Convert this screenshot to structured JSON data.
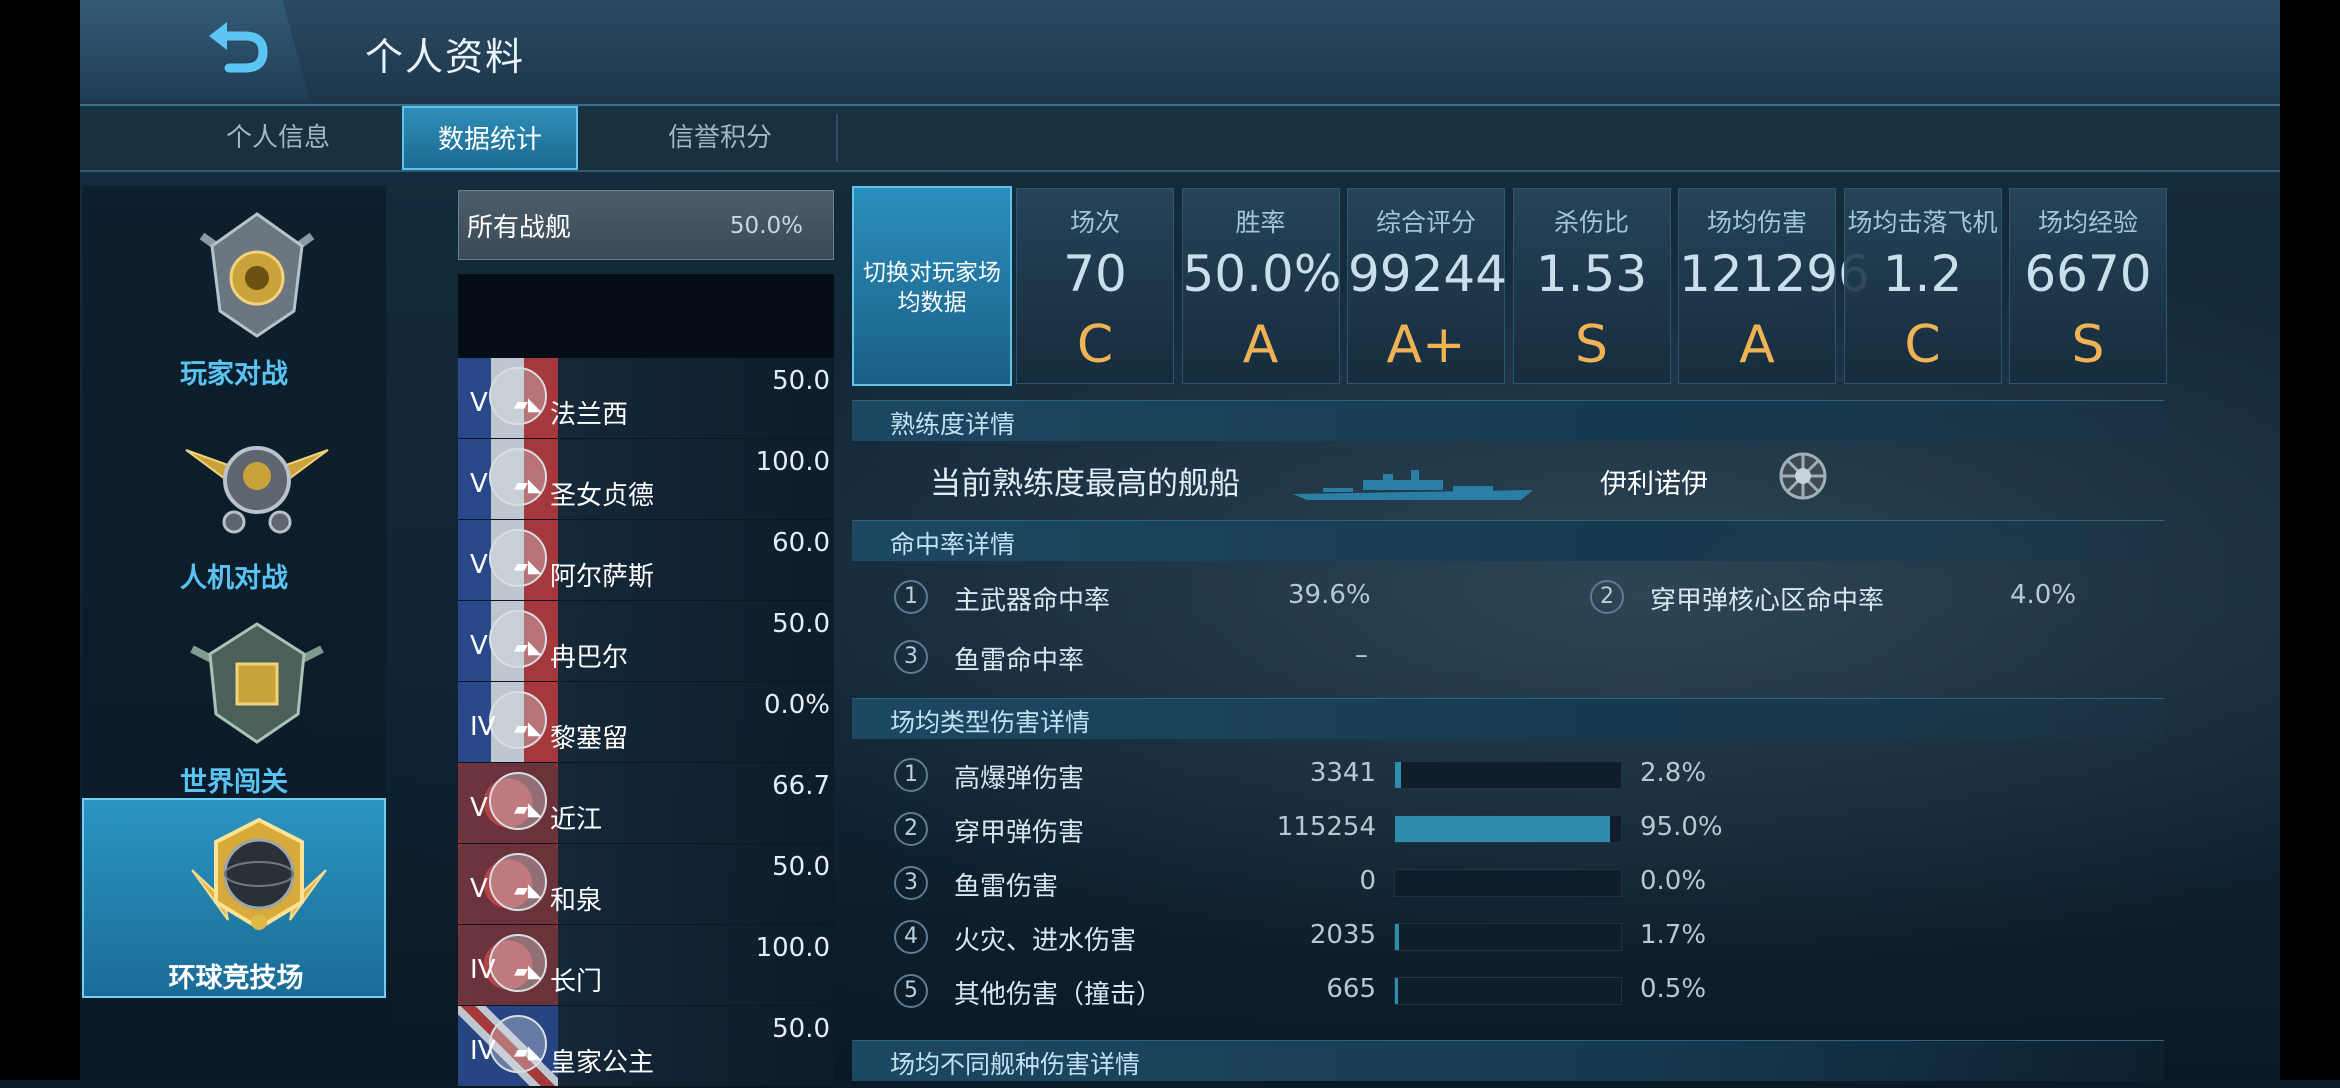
{
  "header": {
    "title": "个人资料"
  },
  "tabs": [
    {
      "label": "个人信息",
      "active": false
    },
    {
      "label": "数据统计",
      "active": true
    },
    {
      "label": "信誉积分",
      "active": false
    }
  ],
  "modes": [
    {
      "label": "玩家对战",
      "active": false
    },
    {
      "label": "人机对战",
      "active": false
    },
    {
      "label": "世界闯关",
      "active": false
    },
    {
      "label": "环球竞技场",
      "active": true
    }
  ],
  "ship_list": {
    "all": {
      "label": "所有战舰",
      "value": "50.0%"
    },
    "ships": [
      {
        "tier": "V",
        "name": "法兰西",
        "winrate": "50.0",
        "nation": "fr"
      },
      {
        "tier": "V",
        "name": "圣女贞德",
        "winrate": "100.0",
        "nation": "fr"
      },
      {
        "tier": "V",
        "name": "阿尔萨斯",
        "winrate": "60.0",
        "nation": "fr"
      },
      {
        "tier": "V",
        "name": "冉巴尔",
        "winrate": "50.0",
        "nation": "fr"
      },
      {
        "tier": "IV",
        "name": "黎塞留",
        "winrate": "0.0%",
        "nation": "fr"
      },
      {
        "tier": "V",
        "name": "近江",
        "winrate": "66.7",
        "nation": "jp"
      },
      {
        "tier": "V",
        "name": "和泉",
        "winrate": "50.0",
        "nation": "jp"
      },
      {
        "tier": "IV",
        "name": "长门",
        "winrate": "100.0",
        "nation": "jp"
      },
      {
        "tier": "IV",
        "name": "皇家公主",
        "winrate": "50.0",
        "nation": "uk"
      }
    ]
  },
  "switch_button": {
    "line1": "切换对玩家场",
    "line2": "均数据"
  },
  "stats": [
    {
      "label": "场次",
      "value": "70",
      "grade": "C"
    },
    {
      "label": "胜率",
      "value": "50.0%",
      "grade": "A"
    },
    {
      "label": "综合评分",
      "value": "99244",
      "grade": "A+"
    },
    {
      "label": "杀伤比",
      "value": "1.53",
      "grade": "S"
    },
    {
      "label": "场均伤害",
      "value": "121296",
      "grade": "A"
    },
    {
      "label": "场均击落飞机",
      "value": "1.2",
      "grade": "C"
    },
    {
      "label": "场均经验",
      "value": "6670",
      "grade": "S"
    }
  ],
  "sections": {
    "proficiency": "熟练度详情",
    "hit_rate": "命中率详情",
    "damage_type": "场均类型伤害详情",
    "damage_class": "场均不同舰种伤害详情"
  },
  "proficiency": {
    "label": "当前熟练度最高的舰船",
    "ship_name": "伊利诺伊"
  },
  "hit_rates": [
    {
      "num": "1",
      "label": "主武器命中率",
      "value": "39.6%"
    },
    {
      "num": "2",
      "label": "穿甲弹核心区命中率",
      "value": "4.0%"
    },
    {
      "num": "3",
      "label": "鱼雷命中率",
      "value": "–"
    }
  ],
  "damage_types": [
    {
      "num": "1",
      "label": "高爆弹伤害",
      "value": "3341",
      "percent": "2.8%",
      "fraction": 0.028
    },
    {
      "num": "2",
      "label": "穿甲弹伤害",
      "value": "115254",
      "percent": "95.0%",
      "fraction": 0.95
    },
    {
      "num": "3",
      "label": "鱼雷伤害",
      "value": "0",
      "percent": "0.0%",
      "fraction": 0.0
    },
    {
      "num": "4",
      "label": "火灾、进水伤害",
      "value": "2035",
      "percent": "1.7%",
      "fraction": 0.017
    },
    {
      "num": "5",
      "label": "其他伤害（撞击）",
      "value": "665",
      "percent": "0.5%",
      "fraction": 0.005
    }
  ],
  "colors": {
    "accent": "#2f8fb8",
    "grade": "#f0b354",
    "bar_fill": "#2f8cac"
  }
}
